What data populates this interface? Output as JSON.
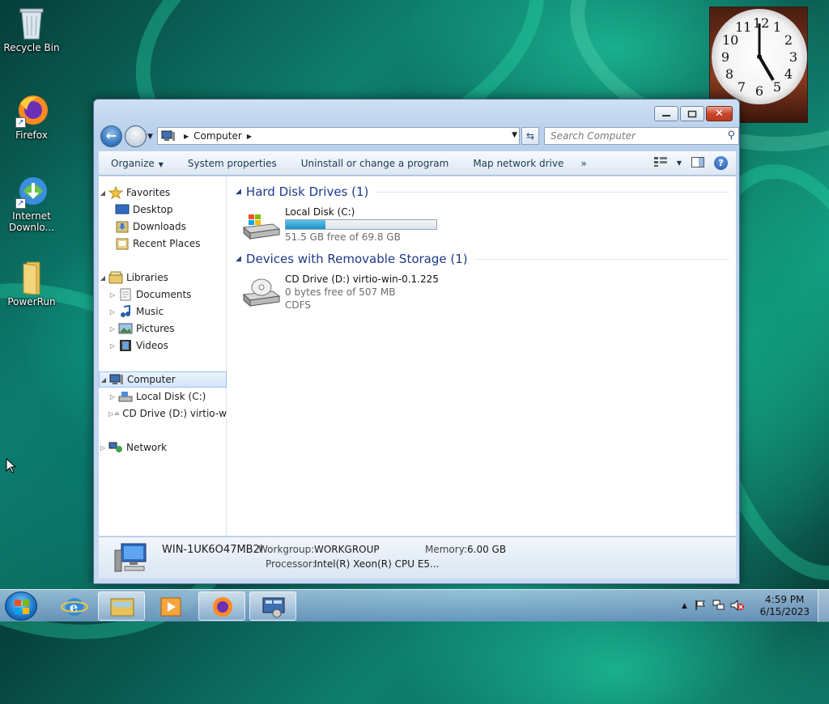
{
  "desktop": {
    "icons": [
      {
        "label": "Recycle Bin",
        "icon": "recycle-bin-icon"
      },
      {
        "label": "Firefox",
        "icon": "firefox-icon"
      },
      {
        "label": "Internet Downlo...",
        "icon": "internet-download-manager-icon"
      },
      {
        "label": "PowerRun",
        "icon": "folder-icon"
      }
    ]
  },
  "clock": {
    "numbers": [
      "12",
      "1",
      "2",
      "3",
      "4",
      "5",
      "6",
      "7",
      "8",
      "9",
      "10",
      "11"
    ]
  },
  "window": {
    "address": {
      "location": "Computer"
    },
    "search": {
      "placeholder": "Search Computer"
    },
    "toolbar": {
      "organize": "Organize",
      "system_properties": "System properties",
      "uninstall": "Uninstall or change a program",
      "map_drive": "Map network drive",
      "more": "»"
    },
    "nav": {
      "favorites": "Favorites",
      "desktop": "Desktop",
      "downloads": "Downloads",
      "recent": "Recent Places",
      "libraries": "Libraries",
      "documents": "Documents",
      "music": "Music",
      "pictures": "Pictures",
      "videos": "Videos",
      "computer": "Computer",
      "local_disk": "Local Disk (C:)",
      "cd_drive": "CD Drive (D:) virtio-w",
      "network": "Network"
    },
    "groups": {
      "hdd": "Hard Disk Drives (1)",
      "removable": "Devices with Removable Storage (1)"
    },
    "drives": {
      "c": {
        "name": "Local Disk (C:)",
        "free": "51.5 GB free of 69.8 GB",
        "used_fraction": 0.262
      },
      "d": {
        "name": "CD Drive (D:) virtio-win-0.1.225",
        "free": "0 bytes free of 507 MB",
        "fs": "CDFS"
      }
    },
    "details": {
      "computer_name": "WIN-1UK6O47MB2I",
      "workgroup_label": "Workgroup:",
      "workgroup": "WORKGROUP",
      "memory_label": "Memory:",
      "memory": "6.00 GB",
      "processor_label": "Processor:",
      "processor": "Intel(R) Xeon(R) CPU E5..."
    }
  },
  "taskbar": {
    "time": "4:59 PM",
    "date": "6/15/2023",
    "tray_icons": [
      "show-hidden-icons-icon",
      "action-center-flag-icon",
      "network-icon",
      "volume-muted-icon"
    ]
  }
}
